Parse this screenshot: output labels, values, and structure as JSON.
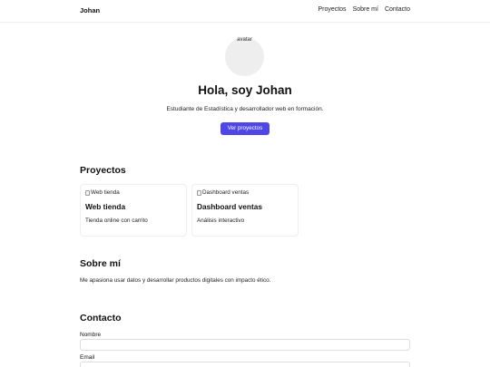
{
  "header": {
    "brand": "Johan",
    "nav": [
      "Proyectos",
      "Sobre mí",
      "Contacto"
    ]
  },
  "hero": {
    "avatar_alt": "avatar",
    "title": "Hola, soy Johan",
    "subtitle": "Estudiante de Estadística y desarrollador web en formación.",
    "button_label": "Ver proyectos"
  },
  "projects": {
    "title": "Proyectos",
    "cards": [
      {
        "image_alt": "Web tienda",
        "title": "Web tienda",
        "description": "Tienda online con carrito"
      },
      {
        "image_alt": "Dashboard ventas",
        "title": "Dashboard ventas",
        "description": "Análisis interactivo"
      }
    ]
  },
  "about": {
    "title": "Sobre mí",
    "text": "Me apasiona usar datos y desarrollar productos digitales con impacto ético."
  },
  "contact": {
    "title": "Contacto",
    "name_label": "Nombre",
    "name_value": "",
    "email_label": "Email",
    "email_value": ""
  },
  "colors": {
    "accent": "#4f46e5",
    "avatar_bg": "#eeeeee"
  }
}
